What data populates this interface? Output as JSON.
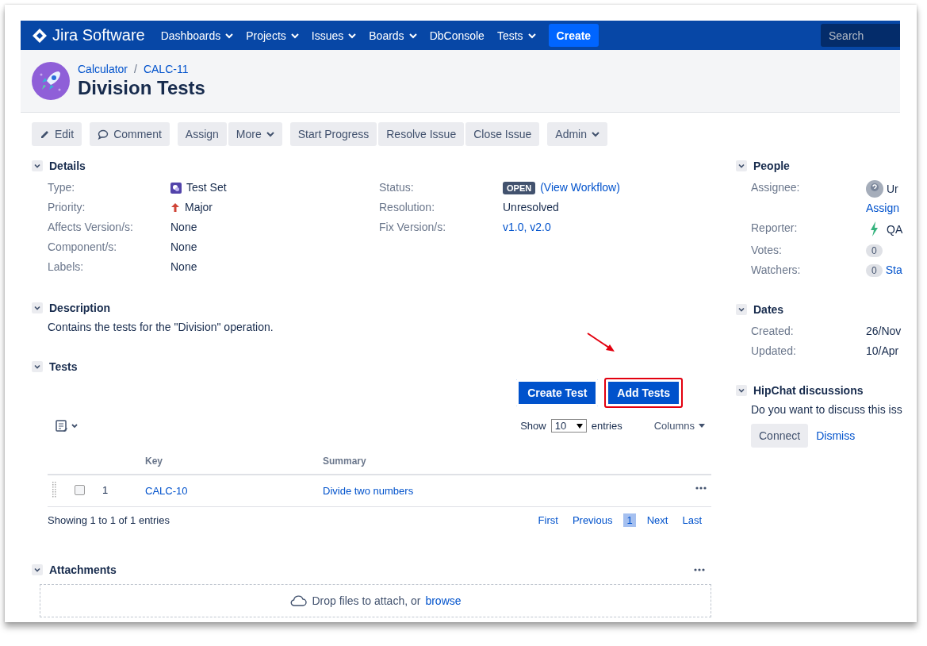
{
  "nav": {
    "logo": "Jira Software",
    "items": [
      {
        "label": "Dashboards",
        "dropdown": true
      },
      {
        "label": "Projects",
        "dropdown": true
      },
      {
        "label": "Issues",
        "dropdown": true
      },
      {
        "label": "Boards",
        "dropdown": true
      },
      {
        "label": "DbConsole",
        "dropdown": false
      },
      {
        "label": "Tests",
        "dropdown": true
      }
    ],
    "create": "Create",
    "search": {
      "placeholder": "Search"
    }
  },
  "header": {
    "breadcrumbs": [
      "Calculator",
      "CALC-11"
    ],
    "separator": "/",
    "title": "Division Tests"
  },
  "toolbar": [
    {
      "buttons": [
        {
          "label": "Edit",
          "kind": "edit",
          "dropdown": false
        }
      ]
    },
    {
      "buttons": [
        {
          "label": "Comment",
          "kind": "comment",
          "dropdown": false
        }
      ]
    },
    {
      "buttons": [
        {
          "label": "Assign",
          "dropdown": false
        },
        {
          "label": "More",
          "dropdown": true
        }
      ]
    },
    {
      "buttons": [
        {
          "label": "Start Progress",
          "dropdown": false
        },
        {
          "label": "Resolve Issue",
          "dropdown": false
        },
        {
          "label": "Close Issue",
          "dropdown": false
        }
      ]
    },
    {
      "buttons": [
        {
          "label": "Admin",
          "dropdown": true
        }
      ]
    }
  ],
  "details": {
    "title": "Details",
    "expanded": true,
    "left": [
      {
        "label": "Type:",
        "kind": "type",
        "value": "Test Set"
      },
      {
        "label": "Priority:",
        "kind": "priority",
        "value": "Major"
      },
      {
        "label": "Affects Version/s:",
        "kind": "text",
        "value": "None"
      },
      {
        "label": "Component/s:",
        "kind": "text",
        "value": "None"
      },
      {
        "label": "Labels:",
        "kind": "text",
        "value": "None"
      }
    ],
    "right": [
      {
        "label": "Status:",
        "kind": "status",
        "value": "OPEN",
        "link": "(View Workflow)"
      },
      {
        "label": "Resolution:",
        "kind": "text",
        "value": "Unresolved"
      },
      {
        "label": "Fix Version/s:",
        "kind": "link",
        "value": "v1.0, v2.0"
      }
    ]
  },
  "description": {
    "title": "Description",
    "expanded": true,
    "text": "Contains the tests for the \"Division\" operation."
  },
  "tests": {
    "title": "Tests",
    "expanded": true,
    "buttons": [
      {
        "label": "Create Test",
        "highlighted": false
      },
      {
        "label": "Add Tests",
        "highlighted": true
      }
    ],
    "show": {
      "before": "Show",
      "value": "10",
      "after": "entries"
    },
    "columns_button": "Columns",
    "columns": [
      "Key",
      "Summary"
    ],
    "rows": [
      {
        "number": "1",
        "key": "CALC-10",
        "summary": "Divide two numbers",
        "checked": false
      }
    ],
    "info": "Showing 1 to 1 of 1 entries",
    "pages": [
      {
        "label": "First",
        "selected": false
      },
      {
        "label": "Previous",
        "selected": false
      },
      {
        "label": "1",
        "selected": true
      },
      {
        "label": "Next",
        "selected": false
      },
      {
        "label": "Last",
        "selected": false
      }
    ]
  },
  "attachments": {
    "title": "Attachments",
    "expanded": true,
    "drop_text": "Drop files to attach, or",
    "browse": "browse"
  },
  "people": {
    "title": "People",
    "expanded": true,
    "fields": [
      {
        "label": "Assignee:",
        "kind": "avatar",
        "value": "Ur",
        "action": "Assign"
      },
      {
        "label": "Reporter:",
        "kind": "app",
        "value": "QA"
      },
      {
        "label": "Votes:",
        "kind": "count",
        "value": "0"
      },
      {
        "label": "Watchers:",
        "kind": "count",
        "value": "0",
        "action": "Sta"
      }
    ]
  },
  "dates": {
    "title": "Dates",
    "expanded": true,
    "fields": [
      {
        "label": "Created:",
        "value": "26/Nov"
      },
      {
        "label": "Updated:",
        "value": "10/Apr"
      }
    ]
  },
  "hipchat": {
    "title": "HipChat discussions",
    "expanded": true,
    "text": "Do you want to discuss this iss",
    "connect": "Connect",
    "dismiss": "Dismiss"
  }
}
